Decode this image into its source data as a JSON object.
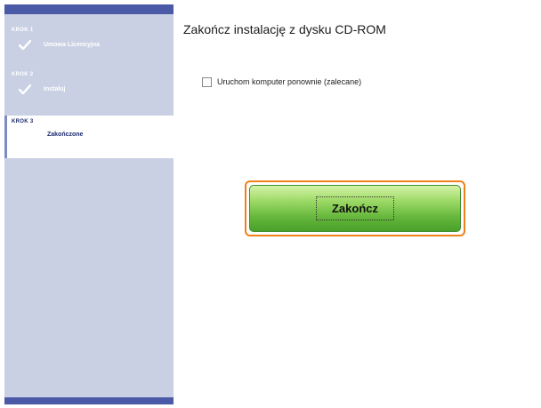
{
  "sidebar": {
    "steps": [
      {
        "step_label": "KROK 1",
        "name": "Umowa Licencyjna",
        "completed": true
      },
      {
        "step_label": "KROK 2",
        "name": "Instaluj",
        "completed": true
      },
      {
        "step_label": "KROK 3",
        "name": "Zakończone",
        "completed": false,
        "active": true
      }
    ],
    "colors": {
      "panel": "#c9d0e3",
      "bar": "#4a5aa6",
      "active_text": "#1c2a70"
    }
  },
  "main": {
    "title": "Zakończ instalację z dysku CD-ROM",
    "restart_checkbox": {
      "label": "Uruchom komputer ponownie (zalecane)",
      "checked": false
    },
    "finish_button": {
      "label": "Zakończ"
    },
    "colors": {
      "button": "#64b63b",
      "highlight": "#f08018"
    }
  }
}
